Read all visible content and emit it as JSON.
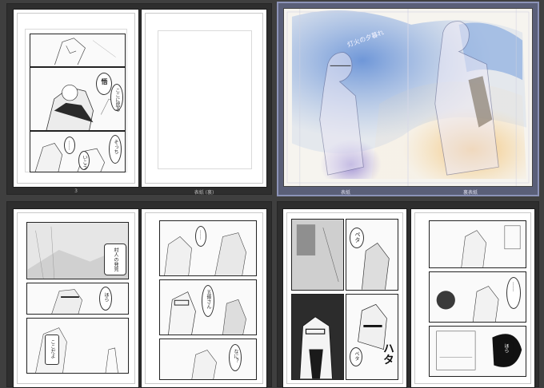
{
  "spreads": [
    {
      "left_label": "3",
      "right_label": "表紙 (裏)"
    },
    {
      "left_label": "表紙",
      "right_label": "裏表紙"
    }
  ],
  "page1": {
    "bubbles": [
      "悟",
      "ここに居る",
      "……",
      "そっち",
      "いこう"
    ]
  },
  "page3": {
    "bubbles": [
      "村人の発見",
      "ほら",
      "ここだよ"
    ]
  },
  "page4": {
    "bubbles": [
      "……",
      "五條さん",
      "なに？"
    ]
  },
  "page5": {
    "bubbles": [
      "ペタ",
      "ペタ",
      "ハタ"
    ]
  },
  "page6": {
    "bubbles": [
      "……",
      "ほら"
    ]
  },
  "cover": {
    "title_text": "灯火の夕暮れ"
  },
  "colors": {
    "selected_border": "#8c93b8",
    "background": "#3f3f3f"
  }
}
